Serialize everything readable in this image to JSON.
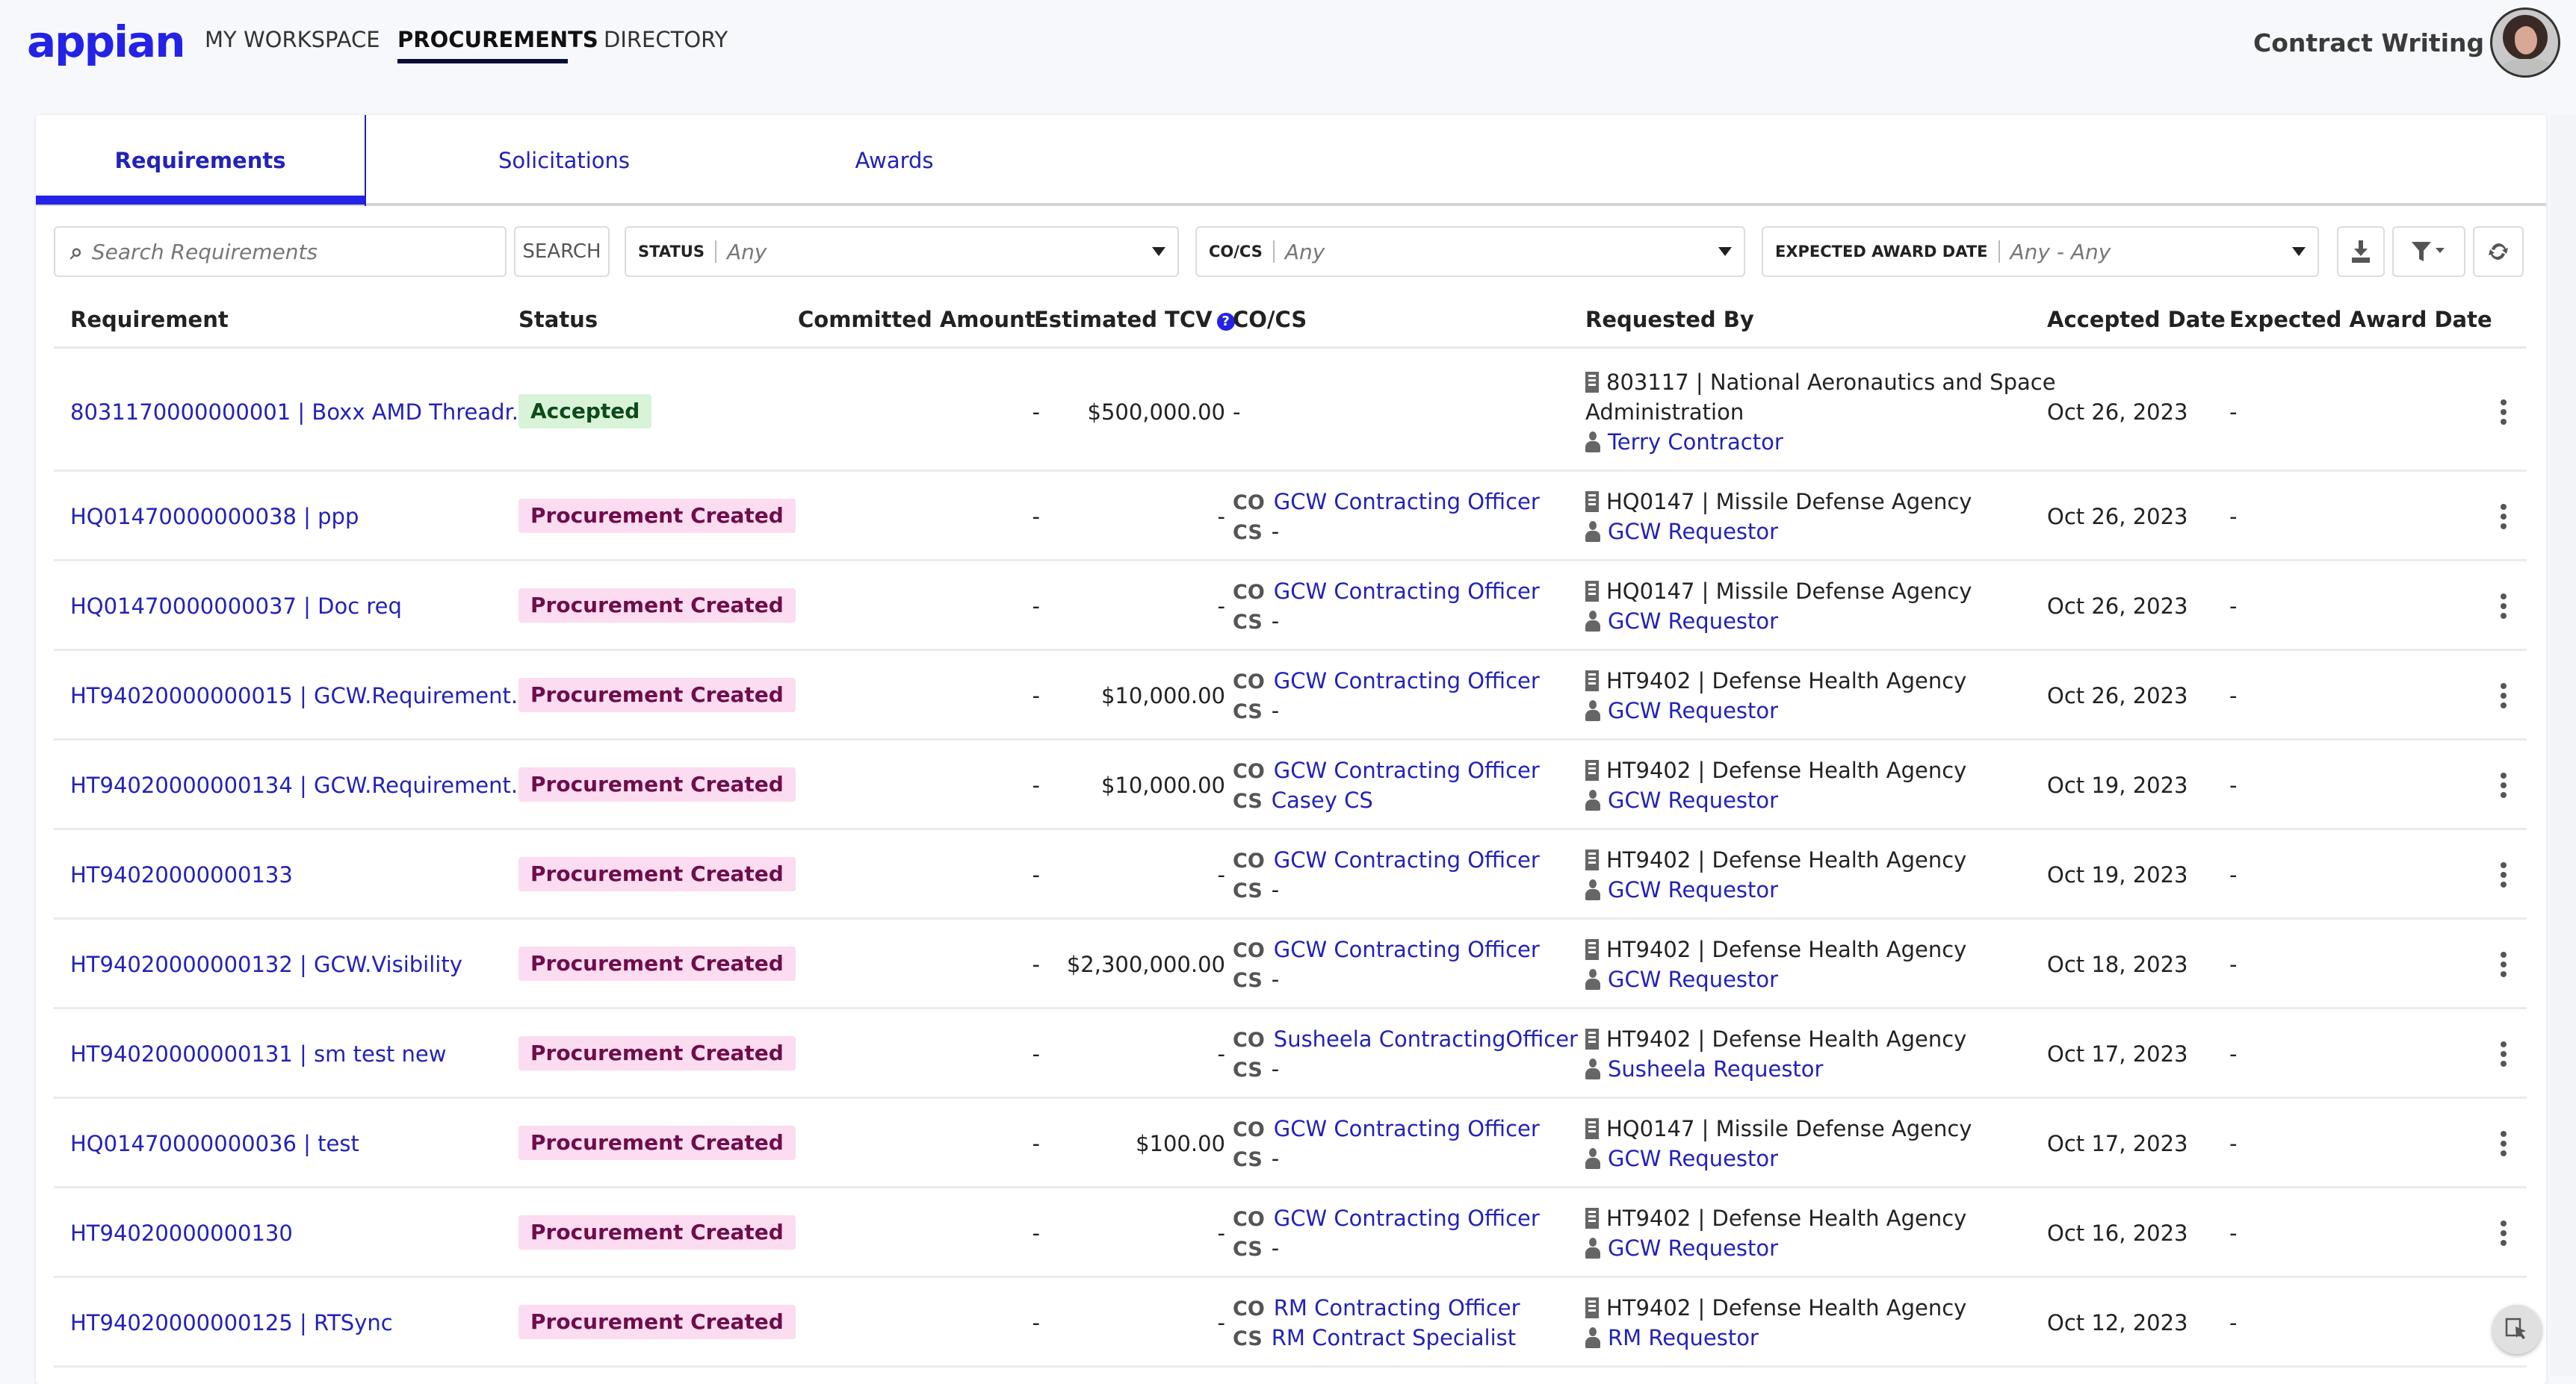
{
  "header": {
    "logo": "appian",
    "nav": [
      {
        "label": "MY WORKSPACE",
        "active": false
      },
      {
        "label": "PROCUREMENTS",
        "active": true
      },
      {
        "label": "DIRECTORY",
        "active": false
      }
    ],
    "app_switcher": "Contract Writing",
    "avatar_icon": "user-avatar"
  },
  "tabs": [
    {
      "label": "Requirements",
      "active": true
    },
    {
      "label": "Solicitations",
      "active": false
    },
    {
      "label": "Awards",
      "active": false
    }
  ],
  "filters": {
    "search_placeholder": "Search Requirements",
    "search_value": "",
    "search_button": "SEARCH",
    "status": {
      "label": "STATUS",
      "value": "Any"
    },
    "cocs": {
      "label": "CO/CS",
      "value": "Any"
    },
    "expected_award_date": {
      "label": "EXPECTED AWARD DATE",
      "value": "Any - Any"
    },
    "icons": [
      "download-icon",
      "filter-icon",
      "refresh-icon"
    ]
  },
  "table": {
    "columns": [
      "Requirement",
      "Status",
      "Committed Amount",
      "Estimated TCV",
      "CO/CS",
      "Requested By",
      "Accepted Date",
      "Expected Award Date"
    ],
    "help_icon": "?",
    "rows": [
      {
        "requirement": "8031170000000001 | Boxx AMD Threadr...",
        "status": "Accepted",
        "status_type": "accepted",
        "committed": "-",
        "tcv": "$500,000.00",
        "co": null,
        "cs": null,
        "cocs_plain": "-",
        "org": "803117 | National Aeronautics and Space",
        "org2": "Administration",
        "requestor": "Terry Contractor",
        "accepted": "Oct 26, 2023",
        "expected": "-"
      },
      {
        "requirement": "HQ01470000000038 | ppp",
        "status": "Procurement Created",
        "status_type": "created",
        "committed": "-",
        "tcv": "-",
        "co": "GCW Contracting Officer",
        "cs": "-",
        "org": "HQ0147 | Missile Defense Agency",
        "requestor": "GCW Requestor",
        "accepted": "Oct 26, 2023",
        "expected": "-"
      },
      {
        "requirement": "HQ01470000000037 | Doc req",
        "status": "Procurement Created",
        "status_type": "created",
        "committed": "-",
        "tcv": "-",
        "co": "GCW Contracting Officer",
        "cs": "-",
        "org": "HQ0147 | Missile Defense Agency",
        "requestor": "GCW Requestor",
        "accepted": "Oct 26, 2023",
        "expected": "-"
      },
      {
        "requirement": "HT94020000000015 | GCW.Requirement...",
        "status": "Procurement Created",
        "status_type": "created",
        "committed": "-",
        "tcv": "$10,000.00",
        "co": "GCW Contracting Officer",
        "cs": "-",
        "org": "HT9402 | Defense Health Agency",
        "requestor": "GCW Requestor",
        "accepted": "Oct 26, 2023",
        "expected": "-"
      },
      {
        "requirement": "HT94020000000134 | GCW.Requirement...",
        "status": "Procurement Created",
        "status_type": "created",
        "committed": "-",
        "tcv": "$10,000.00",
        "co": "GCW Contracting Officer",
        "cs": "Casey CS",
        "org": "HT9402 | Defense Health Agency",
        "requestor": "GCW Requestor",
        "accepted": "Oct 19, 2023",
        "expected": "-"
      },
      {
        "requirement": "HT94020000000133",
        "status": "Procurement Created",
        "status_type": "created",
        "committed": "-",
        "tcv": "-",
        "co": "GCW Contracting Officer",
        "cs": "-",
        "org": "HT9402 | Defense Health Agency",
        "requestor": "GCW Requestor",
        "accepted": "Oct 19, 2023",
        "expected": "-"
      },
      {
        "requirement": "HT94020000000132 | GCW.Visibility",
        "status": "Procurement Created",
        "status_type": "created",
        "committed": "-",
        "tcv": "$2,300,000.00",
        "co": "GCW Contracting Officer",
        "cs": "-",
        "org": "HT9402 | Defense Health Agency",
        "requestor": "GCW Requestor",
        "accepted": "Oct 18, 2023",
        "expected": "-"
      },
      {
        "requirement": "HT94020000000131 | sm test new",
        "status": "Procurement Created",
        "status_type": "created",
        "committed": "-",
        "tcv": "-",
        "co": "Susheela ContractingOfficer",
        "cs": "-",
        "org": "HT9402 | Defense Health Agency",
        "requestor": "Susheela Requestor",
        "accepted": "Oct 17, 2023",
        "expected": "-"
      },
      {
        "requirement": "HQ01470000000036 | test",
        "status": "Procurement Created",
        "status_type": "created",
        "committed": "-",
        "tcv": "$100.00",
        "co": "GCW Contracting Officer",
        "cs": "-",
        "org": "HQ0147 | Missile Defense Agency",
        "requestor": "GCW Requestor",
        "accepted": "Oct 17, 2023",
        "expected": "-"
      },
      {
        "requirement": "HT94020000000130",
        "status": "Procurement Created",
        "status_type": "created",
        "committed": "-",
        "tcv": "-",
        "co": "GCW Contracting Officer",
        "cs": "-",
        "org": "HT9402 | Defense Health Agency",
        "requestor": "GCW Requestor",
        "accepted": "Oct 16, 2023",
        "expected": "-"
      },
      {
        "requirement": "HT94020000000125 | RTSync",
        "status": "Procurement Created",
        "status_type": "created",
        "committed": "-",
        "tcv": "-",
        "co": "RM Contracting Officer",
        "cs": "RM Contract Specialist",
        "org": "HT9402 | Defense Health Agency",
        "requestor": "RM Requestor",
        "accepted": "Oct 12, 2023",
        "expected": "-"
      }
    ],
    "role_labels": {
      "co": "CO",
      "cs": "CS"
    }
  },
  "colors": {
    "brand": "#2322e6",
    "link": "#2322b8",
    "accepted_bg": "#d8f3d8",
    "accepted_text": "#0e4a1a",
    "created_bg": "#fcdcf0",
    "created_text": "#6e0d4a"
  }
}
